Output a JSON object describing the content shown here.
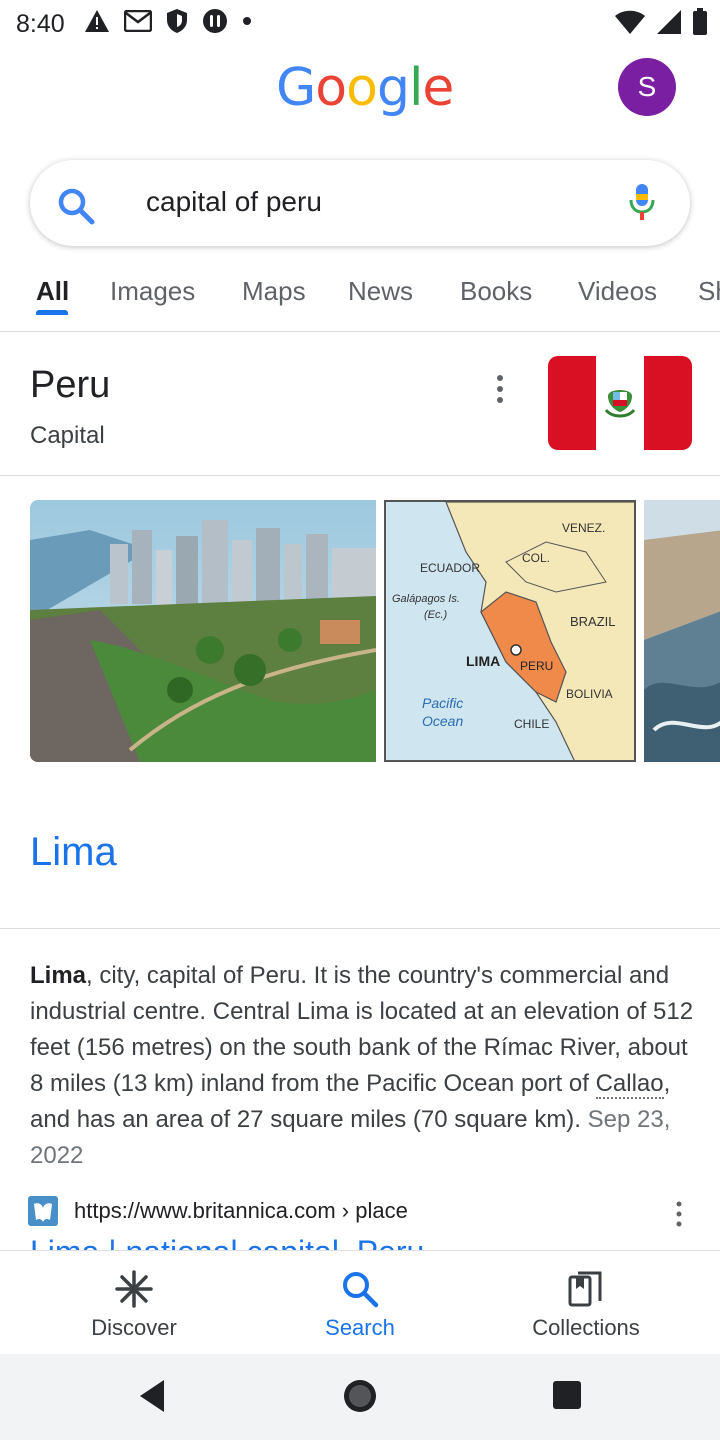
{
  "status_bar": {
    "time": "8:40",
    "left_icons": [
      "alert-icon",
      "gmail-icon",
      "shield-icon",
      "podcast-icon",
      "dot-icon"
    ],
    "right_icons": [
      "wifi-icon",
      "signal-icon",
      "battery-icon"
    ]
  },
  "header": {
    "logo_letters": [
      "G",
      "o",
      "o",
      "g",
      "l",
      "e"
    ],
    "avatar_letter": "S",
    "avatar_color": "#7b1fa2"
  },
  "search": {
    "query": "capital of peru"
  },
  "tabs": [
    {
      "label": "All",
      "active": true
    },
    {
      "label": "Images",
      "active": false
    },
    {
      "label": "Maps",
      "active": false
    },
    {
      "label": "News",
      "active": false
    },
    {
      "label": "Books",
      "active": false
    },
    {
      "label": "Videos",
      "active": false
    },
    {
      "label": "Sh",
      "active": false
    }
  ],
  "knowledge_panel": {
    "title": "Peru",
    "subtitle": "Capital",
    "flag_colors": [
      "#d91023",
      "#ffffff",
      "#d91023"
    ]
  },
  "gallery": {
    "map_labels": {
      "venez": "VENEZ.",
      "ecuador": "ECUADOR",
      "col": "COL.",
      "galapagos": "Galápagos Is.",
      "ec": "(Ec.)",
      "brazil": "BRAZIL",
      "lima": "LIMA",
      "peru": "PERU",
      "bolivia": "BOLIVIA",
      "pacific": "Pacific",
      "ocean": "Ocean",
      "chile": "CHILE"
    }
  },
  "answer": {
    "title": "Lima"
  },
  "snippet": {
    "bold": "Lima",
    "part1": ", city, capital of Peru. It is the country's commercial and industrial centre. Central Lima is located at an elevation of 512 feet (156 metres) on the south bank of the Rímac River, about 8 miles (13 km) inland from the Pacific Ocean port of ",
    "link": "Callao",
    "part2": ", and has an area of 27 square miles (70 square km). ",
    "date": "Sep 23, 2022"
  },
  "source": {
    "url": "https://www.britannica.com › place",
    "title_cut": "Lima | national capital, Peru"
  },
  "bottom_nav": {
    "discover": "Discover",
    "search": "Search",
    "collections": "Collections"
  }
}
